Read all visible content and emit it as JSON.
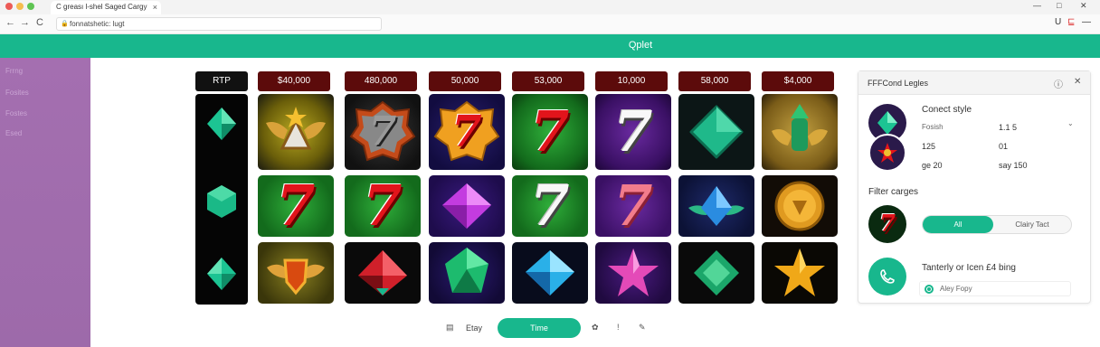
{
  "browser": {
    "tab_title": "C greası l-shel Saged Cargy",
    "tab_close": "×",
    "url": "fonnatshetic: lugt",
    "back": "←",
    "forward": "→",
    "reload": "C",
    "lock": "🔒",
    "right_icons": [
      "U",
      "⊑",
      "—"
    ],
    "win_controls": [
      "—",
      "□",
      "✕"
    ]
  },
  "header": {
    "title": "Qplet"
  },
  "sidebar": {
    "items": [
      "Frrng",
      "Fosites",
      "Fostes",
      "Esed"
    ]
  },
  "reels": {
    "rtp_label": "RTP",
    "columns": [
      "$40,000",
      "480,000",
      "50,000",
      "53,000",
      "10,000",
      "58,000",
      "$4,000"
    ]
  },
  "toolbar": {
    "calendar_icon": "▤",
    "label_left": "Etay",
    "time_button": "Time",
    "icons": [
      "✿",
      "!",
      "✎"
    ]
  },
  "panel": {
    "title": "FFFCond Legles",
    "info_icon": "ⓘ",
    "close_icon": "✕",
    "section1_heading": "Conect style",
    "row1_label": "Fosish",
    "row1_value": "1.1 5",
    "chevron": "⌄",
    "row2_left": "125",
    "row2_right": "01",
    "row3_left": "ge 20",
    "row3_right": "say 150",
    "section2_heading": "Filter carges",
    "seg_on": "All",
    "seg_off": "Clairy Tact",
    "section3_heading": "Tanterly or Icen £4 bing",
    "radio_label": "Aley Fopy"
  },
  "colors": {
    "accent": "#18b78d",
    "header_bar": "#18b78d",
    "sidebar": "#a46fb0",
    "column_header": "#5c0b0b"
  }
}
